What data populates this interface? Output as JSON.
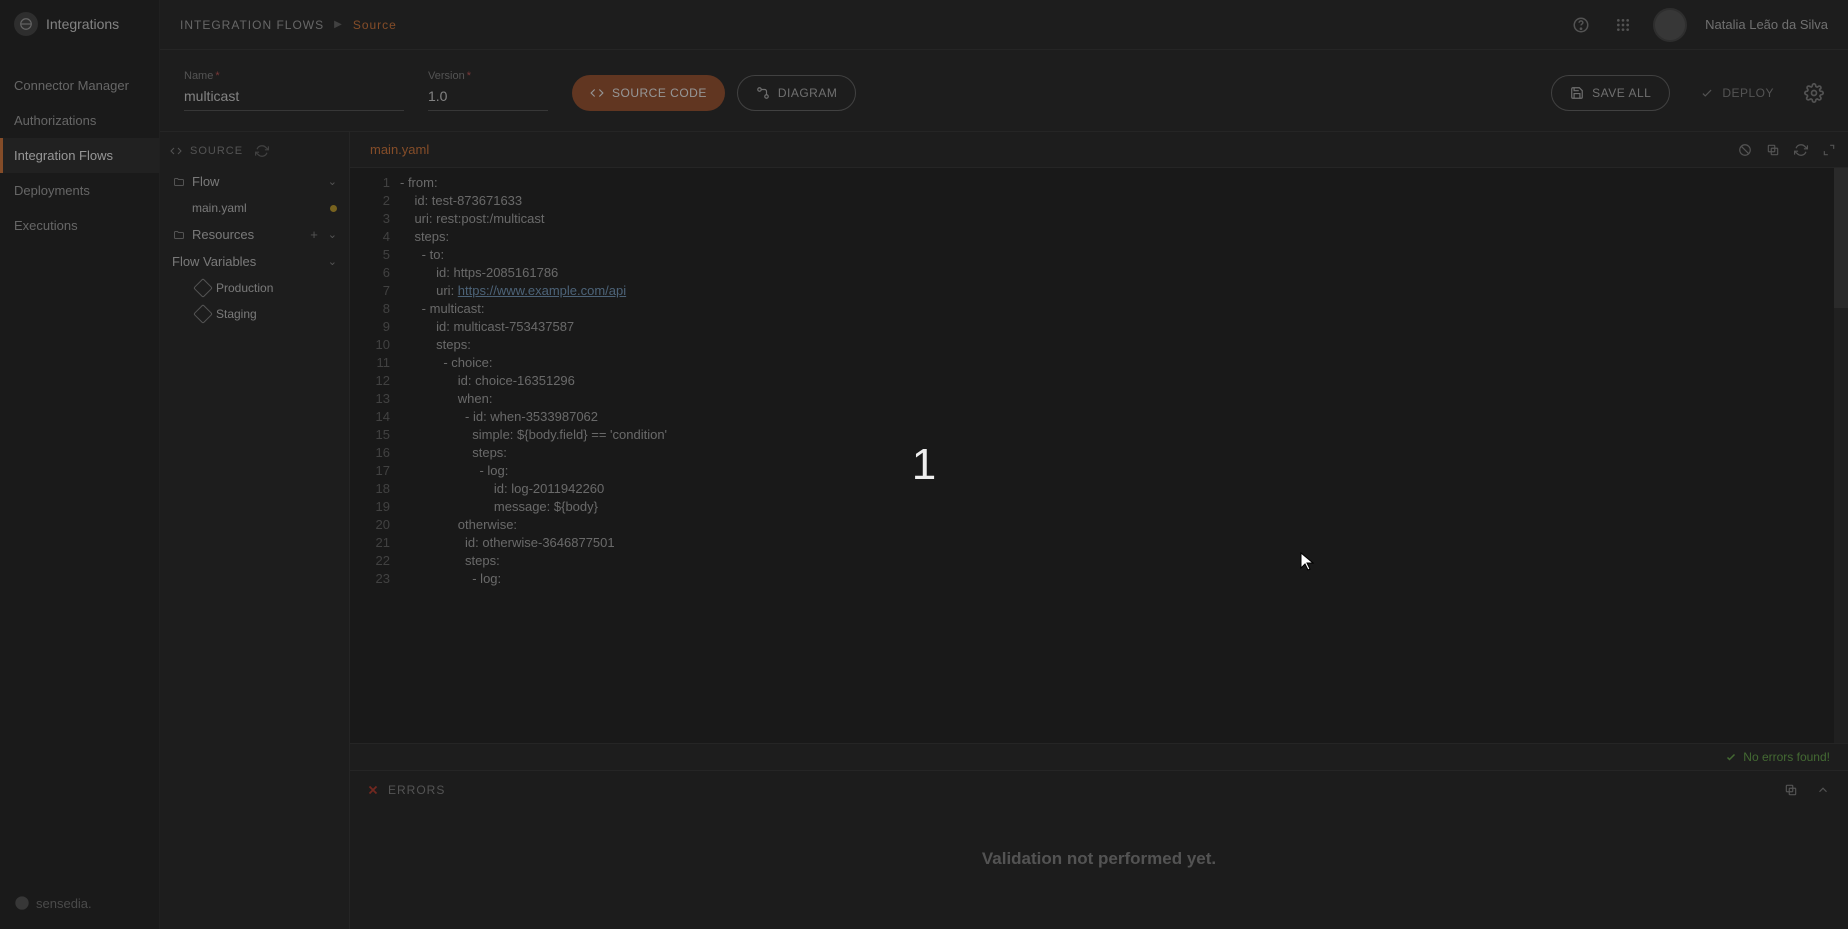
{
  "app": {
    "title": "Integrations",
    "footer_brand": "sensedia."
  },
  "sidebar": {
    "items": [
      {
        "label": "Connector Manager"
      },
      {
        "label": "Authorizations"
      },
      {
        "label": "Integration Flows"
      },
      {
        "label": "Deployments"
      },
      {
        "label": "Executions"
      }
    ]
  },
  "topbar": {
    "breadcrumb_root": "INTEGRATION FLOWS",
    "breadcrumb_leaf": "Source",
    "user_name": "Natalia Leão da Silva"
  },
  "form": {
    "name_label": "Name",
    "name_value": "multicast",
    "version_label": "Version",
    "version_value": "1.0",
    "btn_source": "SOURCE CODE",
    "btn_diagram": "DIAGRAM",
    "btn_save": "SAVE ALL",
    "btn_deploy": "DEPLOY"
  },
  "tree": {
    "header": "SOURCE",
    "flow_label": "Flow",
    "file_main": "main.yaml",
    "resources_label": "Resources",
    "vars_label": "Flow Variables",
    "var_prod": "Production",
    "var_staging": "Staging"
  },
  "editor": {
    "tab_name": "main.yaml",
    "status_text": "No errors found!",
    "lines": [
      "- from:",
      "    id: test-873671633",
      "    uri: rest:post:/multicast",
      "    steps:",
      "      - to:",
      "          id: https-2085161786",
      "          uri: https://www.example.com/api",
      "      - multicast:",
      "          id: multicast-753437587",
      "          steps:",
      "            - choice:",
      "                id: choice-16351296",
      "                when:",
      "                  - id: when-3533987062",
      "                    simple: ${body.field} == 'condition'",
      "                    steps:",
      "                      - log:",
      "                          id: log-2011942260",
      "                          message: ${body}",
      "                otherwise:",
      "                  id: otherwise-3646877501",
      "                  steps:",
      "                    - log:"
    ]
  },
  "errors": {
    "label": "ERRORS",
    "body_msg": "Validation not performed yet."
  },
  "overlay": {
    "badge": "1"
  }
}
